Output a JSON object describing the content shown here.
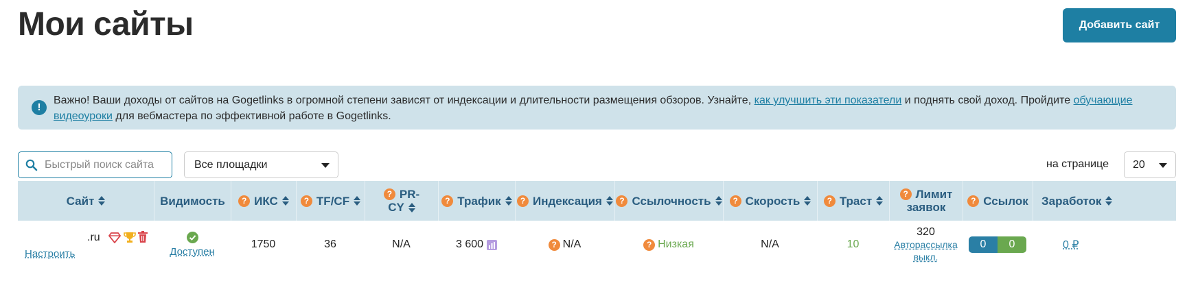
{
  "page": {
    "title": "Мои сайты",
    "add_button": "Добавить сайт"
  },
  "alert": {
    "text_1": "Важно! Ваши доходы от сайтов на Gogetlinks в огромной степени зависят от индексации и длительности размещения обзоров. Узнайте, ",
    "link_1": "как улучшить эти показатели",
    "text_2": " и поднять свой доход. Пройдите ",
    "link_2": "обучающие видеоуроки",
    "text_3": " для вебмастера по эффективной работе в Gogetlinks."
  },
  "filters": {
    "search_placeholder": "Быстрый поиск сайта",
    "platform_select": "Все площадки",
    "per_page_label": "на странице",
    "per_page_value": "20"
  },
  "table": {
    "headers": {
      "site": "Сайт",
      "visibility": "Видимость",
      "iks": "ИКС",
      "tfcf": "TF/CF",
      "prcy_1": "PR-",
      "prcy_2": "CY",
      "traffic": "Трафик",
      "indexation": "Индексация",
      "linkability": "Ссылочность",
      "speed": "Скорость",
      "trust": "Траст",
      "limit_1": "Лимит",
      "limit_2": "заявок",
      "links": "Ссылок",
      "earnings": "Заработок"
    },
    "row": {
      "domain": ".ru",
      "configure": "Настроить",
      "visibility": "Доступен",
      "iks": "1750",
      "tfcf": "36",
      "prcy": "N/A",
      "traffic": "3 600",
      "indexation": "N/A",
      "linkability": "Низкая",
      "speed": "N/A",
      "trust": "10",
      "limit": "320",
      "autosend_1": "Авторассылка",
      "autosend_2": "выкл.",
      "links_left": "0",
      "links_right": "0",
      "earnings": "0 ₽"
    }
  },
  "colors": {
    "brand": "#1e7fa3",
    "header_bg": "#cfe2ea",
    "question_icon": "#f08a3c",
    "green": "#6aa84f"
  }
}
